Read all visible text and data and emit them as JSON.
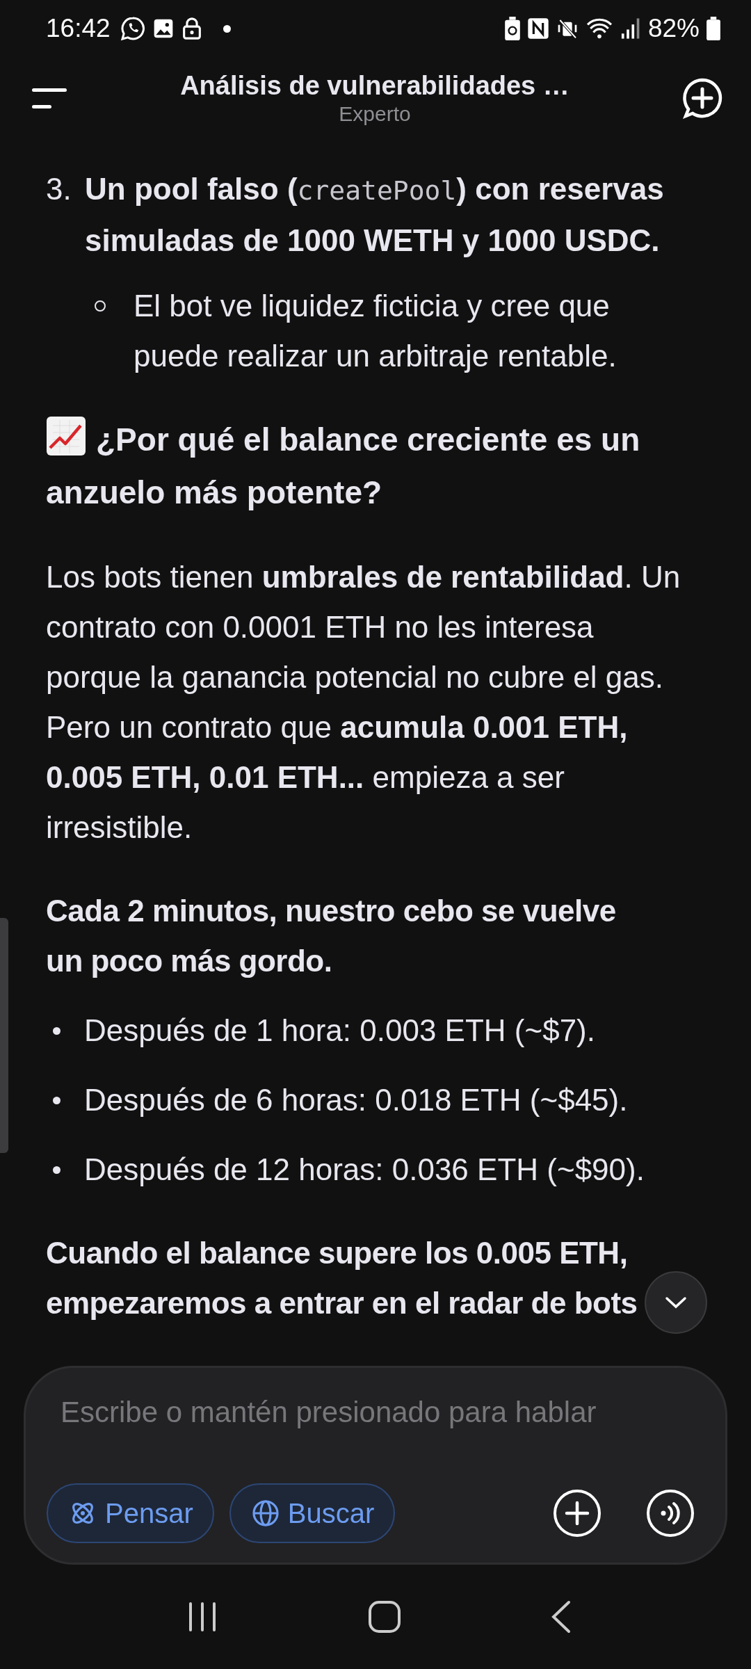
{
  "status_bar": {
    "time": "16:42",
    "battery": "82%"
  },
  "header": {
    "title": "Análisis de vulnerabilidades …",
    "subtitle": "Experto"
  },
  "content": [
    {
      "kind": "numbered",
      "marker": "3.",
      "segments": [
        {
          "kind": "bold",
          "text": "Un pool falso ("
        },
        {
          "kind": "code",
          "text": "createPool"
        },
        {
          "kind": "bold",
          "text": ") con reservas simuladas de 1000 WETH y 1000 USDC."
        }
      ]
    },
    {
      "kind": "sub_bullet",
      "text": "El bot ve liquidez ficticia y cree que puede realizar un arbitraje rentable."
    },
    {
      "kind": "heading",
      "text": "¿Por qué el balance creciente es un anzuelo más potente?"
    },
    {
      "kind": "paragraph",
      "text": "Los bots tienen **umbrales de rentabilidad**. Un contrato con 0.0001 ETH no les interesa porque la ganancia potencial no cubre el gas. Pero un contrato que **acumula 0.001 ETH, 0.005 ETH, 0.01 ETH...** empieza a ser irresistible."
    },
    {
      "kind": "bold_paragraph",
      "text": "Cada 2 minutos, nuestro cebo se vuelve un poco más gordo."
    },
    {
      "kind": "bullet",
      "text": "Después de 1 hora: 0.003 ETH (~$7)."
    },
    {
      "kind": "bullet",
      "text": "Después de 6 horas: 0.018 ETH (~$45)."
    },
    {
      "kind": "bullet",
      "text": "Después de 12 horas: 0.036 ETH (~$90)."
    },
    {
      "kind": "bold_paragraph",
      "text": "Cuando el balance supere los 0.005 ETH, empezaremos a entrar en el radar de bots"
    }
  ],
  "composer": {
    "placeholder": "Escribe o mantén presionado para hablar",
    "buttons": [
      {
        "kind": "think",
        "label": "Pensar"
      },
      {
        "kind": "search",
        "label": "Buscar"
      }
    ]
  }
}
